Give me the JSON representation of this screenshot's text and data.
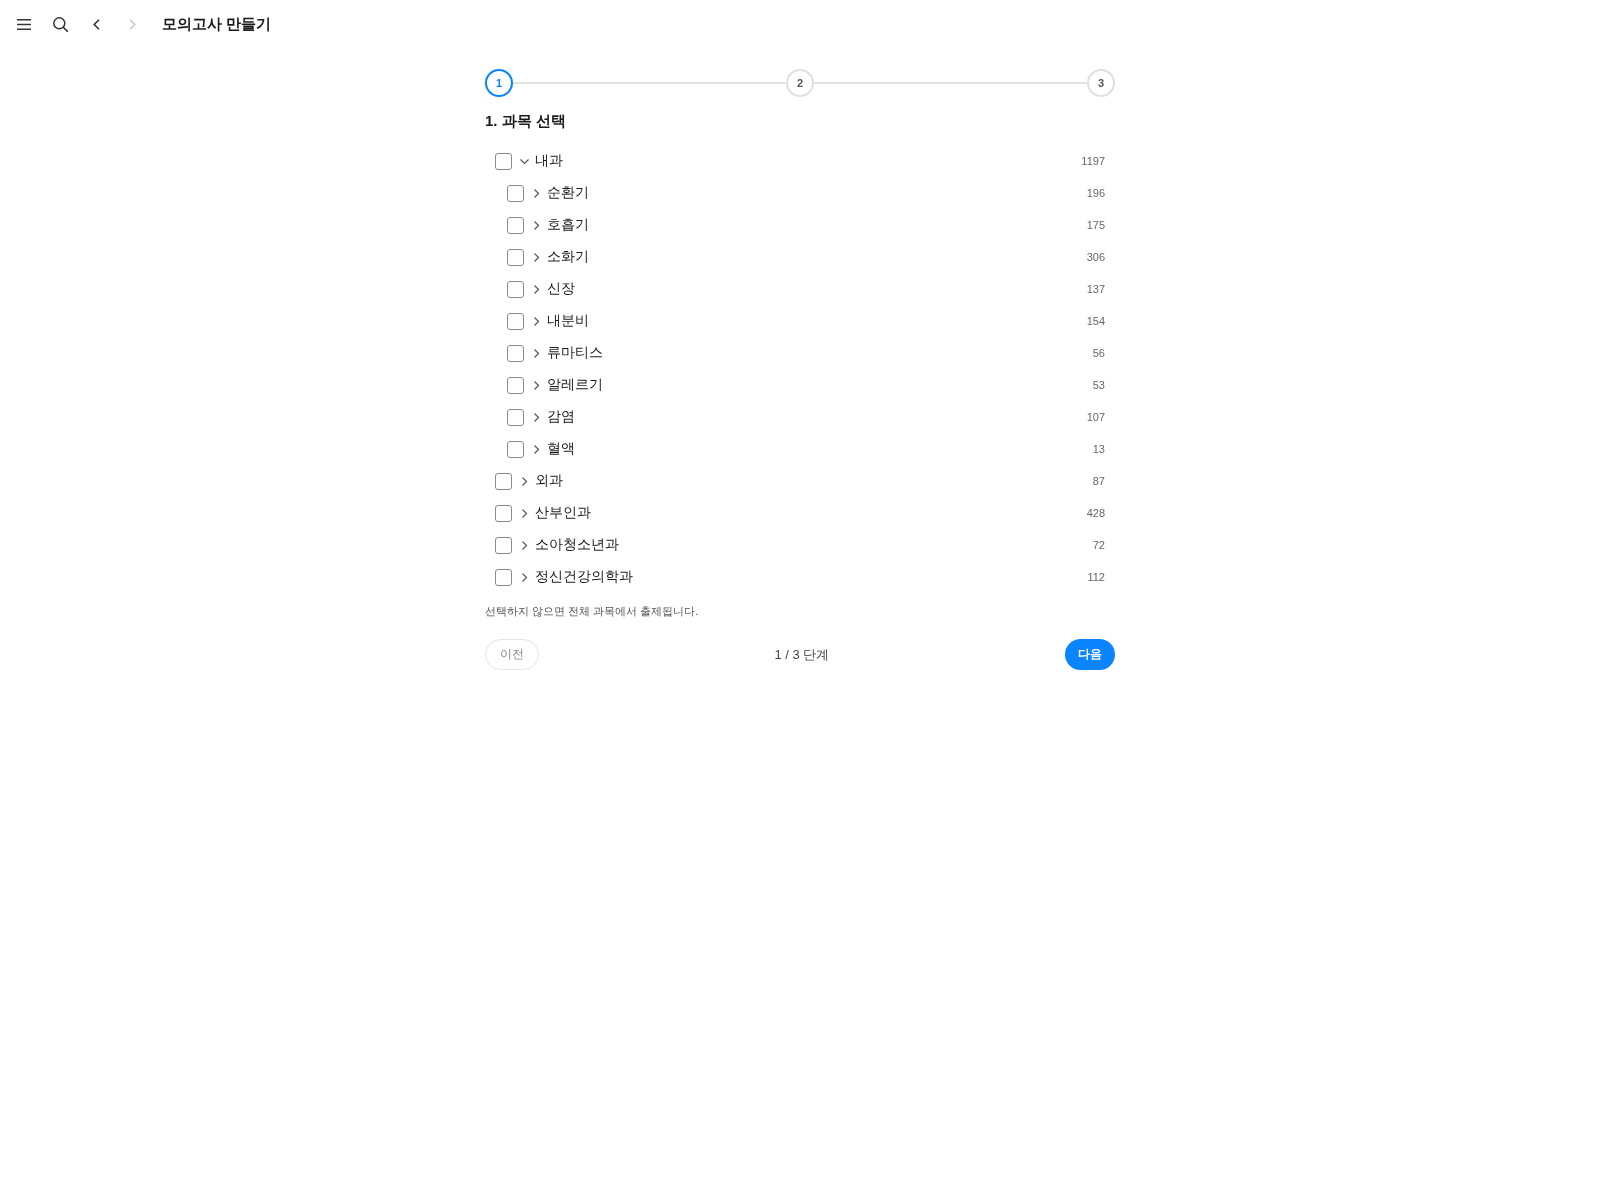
{
  "toolbar": {
    "nav_buttons": [
      {
        "kind": "menu",
        "disabled": false
      },
      {
        "kind": "search",
        "disabled": false
      },
      {
        "kind": "back",
        "disabled": false
      },
      {
        "kind": "forward",
        "disabled": true
      }
    ],
    "title": "모의고사 만들기"
  },
  "stepper": {
    "steps": [
      {
        "label": "1",
        "selected": true
      },
      {
        "label": "2",
        "selected": false
      },
      {
        "label": "3",
        "selected": false
      }
    ]
  },
  "section_title": "1. 과목 선택",
  "subjects": [
    {
      "name": "내과",
      "count": "1197",
      "checked": false,
      "expanded": true,
      "children": [
        {
          "name": "순환기",
          "count": "196",
          "checked": false,
          "expanded": false
        },
        {
          "name": "호흡기",
          "count": "175",
          "checked": false,
          "expanded": false
        },
        {
          "name": "소화기",
          "count": "306",
          "checked": false,
          "expanded": false
        },
        {
          "name": "신장",
          "count": "137",
          "checked": false,
          "expanded": false
        },
        {
          "name": "내분비",
          "count": "154",
          "checked": false,
          "expanded": false
        },
        {
          "name": "류마티스",
          "count": "56",
          "checked": false,
          "expanded": false
        },
        {
          "name": "알레르기",
          "count": "53",
          "checked": false,
          "expanded": false
        },
        {
          "name": "감염",
          "count": "107",
          "checked": false,
          "expanded": false
        },
        {
          "name": "혈액",
          "count": "13",
          "checked": false,
          "expanded": false
        }
      ]
    },
    {
      "name": "외과",
      "count": "87",
      "checked": false,
      "expanded": false
    },
    {
      "name": "산부인과",
      "count": "428",
      "checked": false,
      "expanded": false
    },
    {
      "name": "소아청소년과",
      "count": "72",
      "checked": false,
      "expanded": false
    },
    {
      "name": "정신건강의학과",
      "count": "112",
      "checked": false,
      "expanded": false
    }
  ],
  "note": "선택하지 않으면 전체 과목에서 출제됩니다.",
  "footer": {
    "prev_button": "이전",
    "step_text": "1 / 3 단계",
    "next_button": "다음"
  }
}
